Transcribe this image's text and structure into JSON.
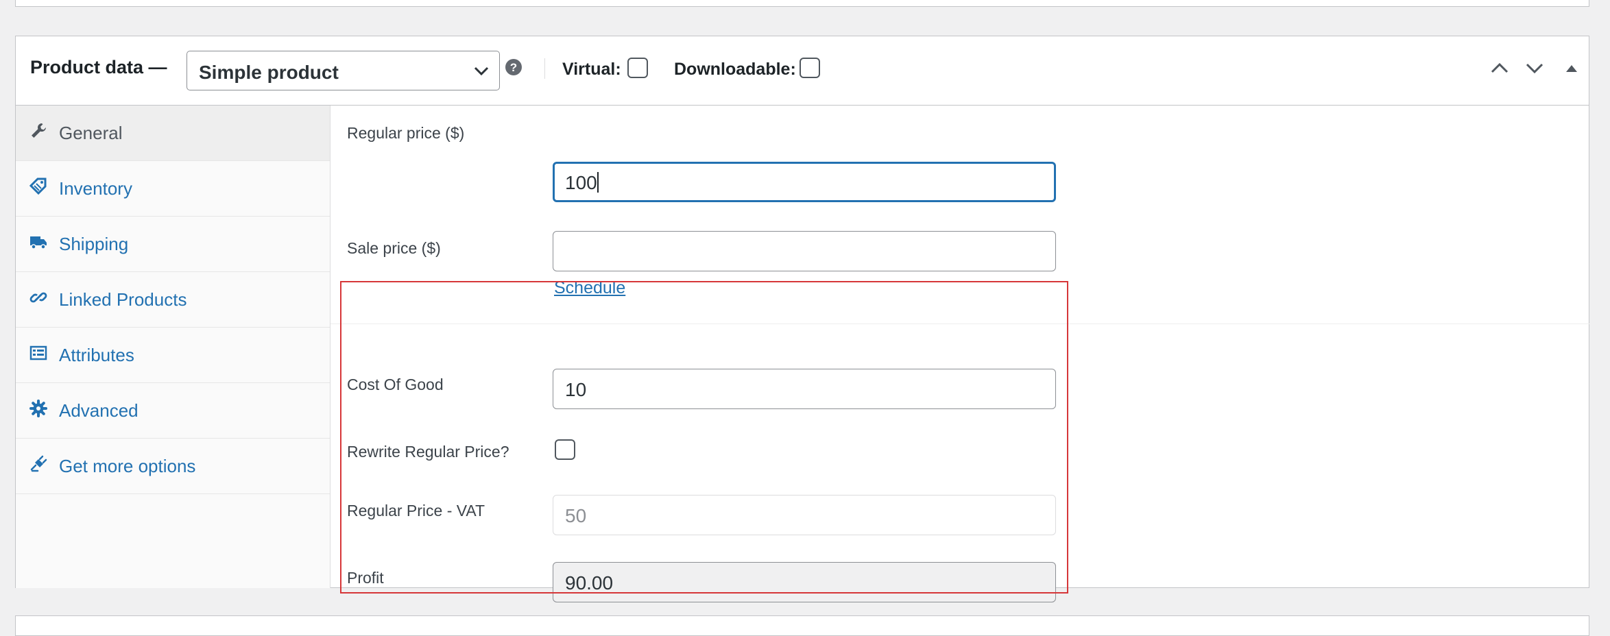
{
  "header": {
    "title": "Product data —",
    "product_type": "Simple product",
    "virtual_label": "Virtual:",
    "downloadable_label": "Downloadable:"
  },
  "tabs": [
    {
      "label": "General",
      "icon": "wrench-icon",
      "active": true
    },
    {
      "label": "Inventory",
      "icon": "tag-icon",
      "active": false
    },
    {
      "label": "Shipping",
      "icon": "truck-icon",
      "active": false
    },
    {
      "label": "Linked Products",
      "icon": "link-icon",
      "active": false
    },
    {
      "label": "Attributes",
      "icon": "list-icon",
      "active": false
    },
    {
      "label": "Advanced",
      "icon": "gear-icon",
      "active": false
    },
    {
      "label": "Get more options",
      "icon": "plugin-icon",
      "active": false
    }
  ],
  "fields": {
    "regular_price": {
      "label": "Regular price ($)",
      "value": "100"
    },
    "sale_price": {
      "label": "Sale price ($)",
      "value": ""
    },
    "schedule_link": "Schedule",
    "cost_of_good": {
      "label": "Cost Of Good",
      "value": "10"
    },
    "rewrite_regular_price": {
      "label": "Rewrite Regular Price?",
      "checked": false
    },
    "regular_price_vat": {
      "label": "Regular Price - VAT",
      "placeholder": "50"
    },
    "profit": {
      "label": "Profit",
      "value": "90.00"
    }
  },
  "colors": {
    "accent": "#2271b1",
    "highlight_border": "#d63638",
    "border": "#c3c4c7",
    "page_bg": "#f0f0f1"
  }
}
